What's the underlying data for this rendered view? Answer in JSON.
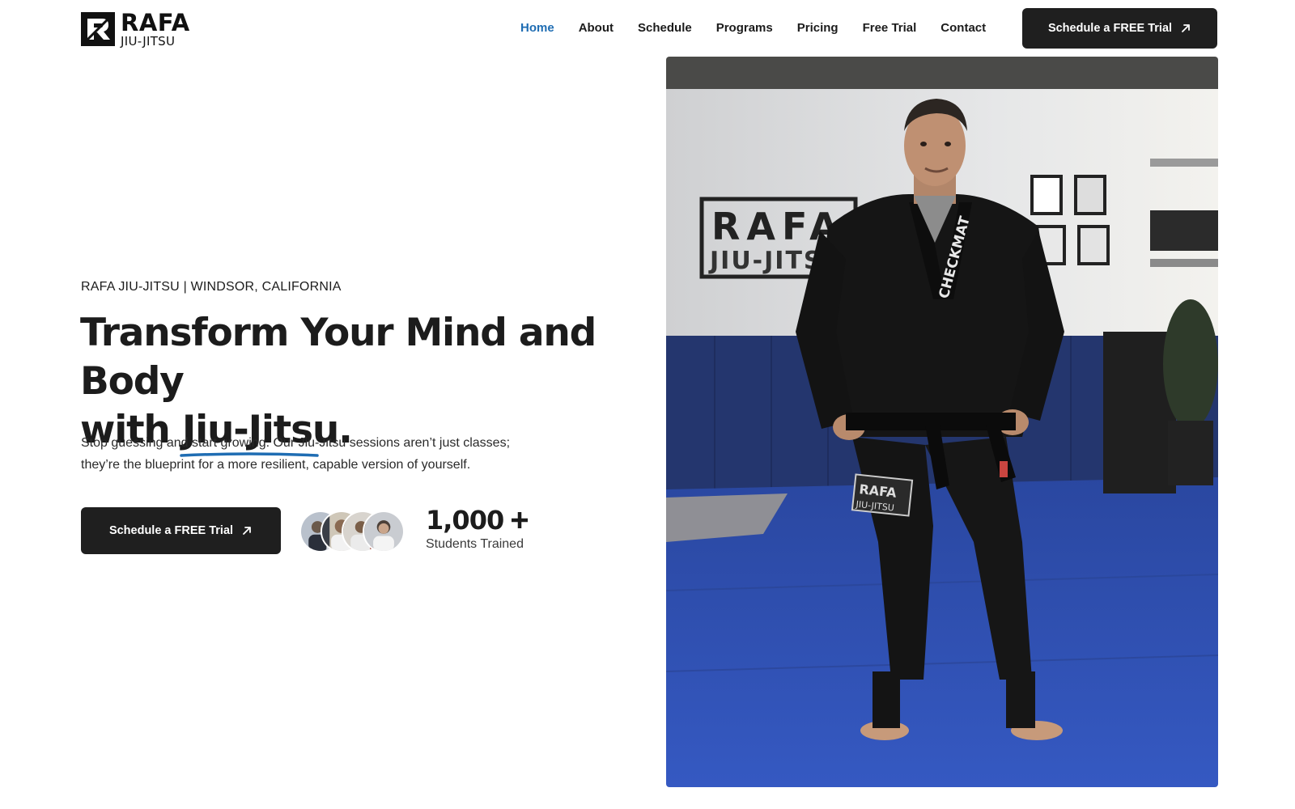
{
  "brand": {
    "name": "RAFA",
    "sub": "JIU-JITSU"
  },
  "nav": {
    "items": [
      {
        "label": "Home",
        "active": true
      },
      {
        "label": "About",
        "active": false
      },
      {
        "label": "Schedule",
        "active": false
      },
      {
        "label": "Programs",
        "active": false
      },
      {
        "label": "Pricing",
        "active": false
      },
      {
        "label": "Free Trial",
        "active": false
      },
      {
        "label": "Contact",
        "active": false
      }
    ],
    "cta_label": "Schedule a FREE Trial"
  },
  "hero": {
    "eyebrow": "RAFA JIU-JITSU | WINDSOR, CALIFORNIA",
    "headline_line1": "Transform Your Mind and Body",
    "headline_with": "with",
    "headline_highlight": "Jiu-Jitsu",
    "headline_period": ".",
    "description": "Stop guessing and start growing. Our Jiu-Jitsu sessions aren’t just classes; they’re the blueprint for a more resilient, capable version of yourself.",
    "cta_label": "Schedule a FREE Trial",
    "stat_value": "1,000",
    "stat_label": "Students Trained",
    "photo_sign_line1": "RAFA",
    "photo_sign_line2": "JIU-JITS",
    "photo_patch_line1": "RAFA",
    "photo_patch_line2": "JIU-JITSU",
    "photo_belt_text": "CHECKMAT"
  },
  "colors": {
    "accent": "#1f6db3",
    "button": "#1f1f1f",
    "mat": "#2f4fa8"
  }
}
